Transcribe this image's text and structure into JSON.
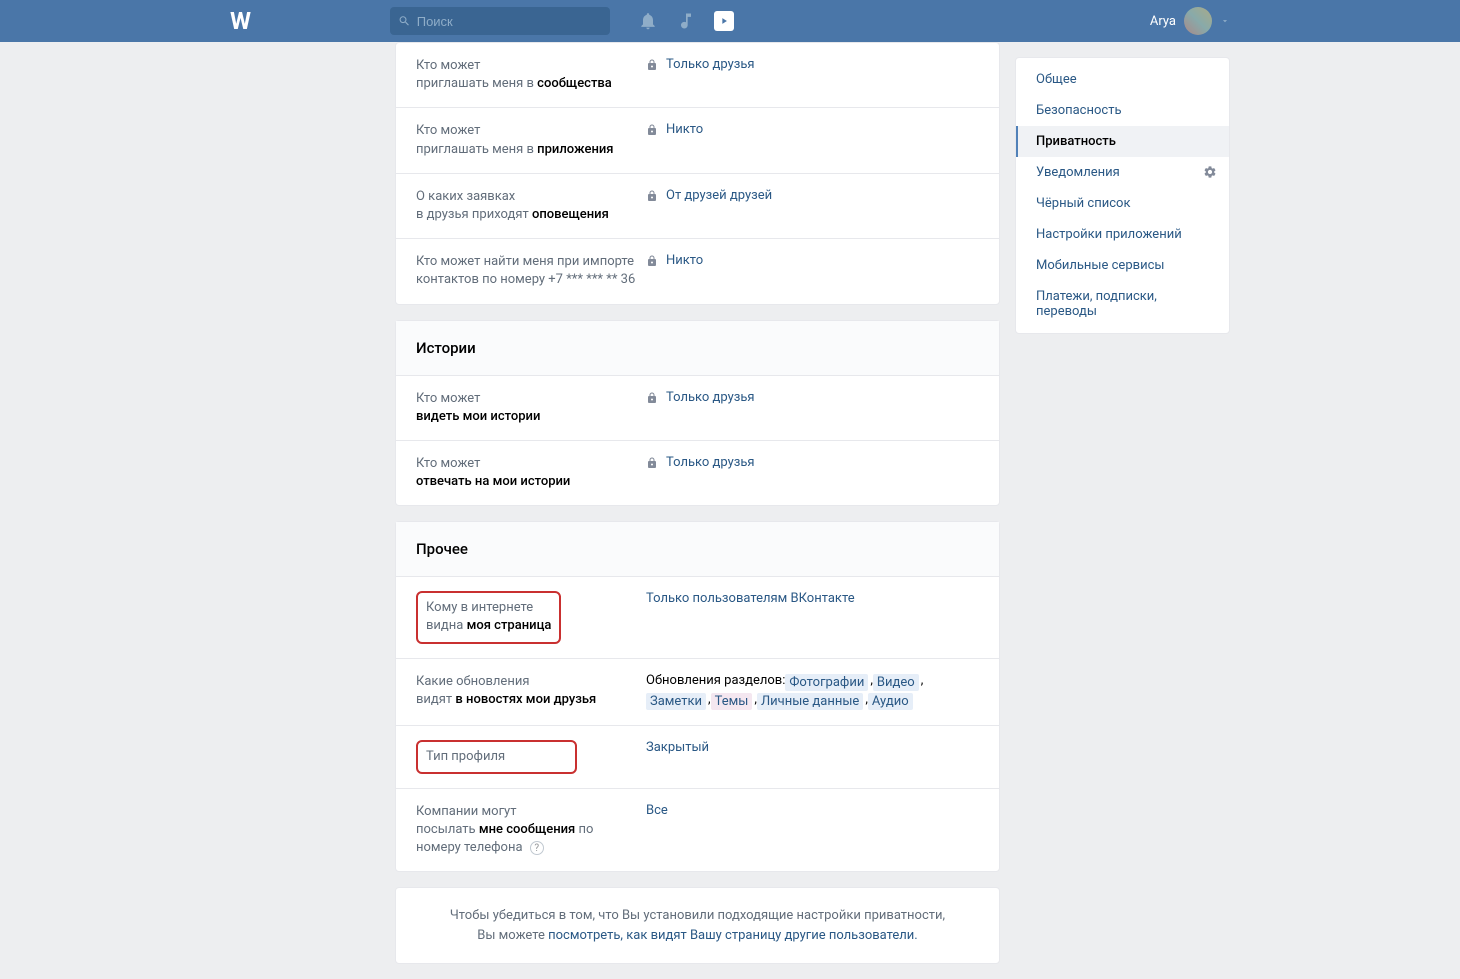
{
  "header": {
    "search_placeholder": "Поиск",
    "user_name": "Arya"
  },
  "sections": [
    {
      "rows": [
        {
          "label_pre": "Кто может",
          "label_bold_pre": "приглашать меня в ",
          "label_bold": "сообщества",
          "value": "Только друзья",
          "locked": true
        },
        {
          "label_pre": "Кто может",
          "label_bold_pre": "приглашать меня в ",
          "label_bold": "приложения",
          "value": "Никто",
          "locked": true
        },
        {
          "label_pre": "О каких заявках",
          "label_bold_pre": "в друзья приходят ",
          "label_bold": "оповещения",
          "value": "От друзей друзей",
          "locked": true
        },
        {
          "label_pre": "Кто может найти меня при импорте",
          "label_bold_pre": "контактов по номеру +7 *** *** ** 36",
          "label_bold": "",
          "value": "Никто",
          "locked": true
        }
      ]
    }
  ],
  "stories": {
    "title": "Истории",
    "rows": [
      {
        "label_pre": "Кто может",
        "label_bold": "видеть мои истории",
        "value": "Только друзья",
        "locked": true
      },
      {
        "label_pre": "Кто может",
        "label_bold": "отвечать на мои истории",
        "value": "Только друзья",
        "locked": true
      }
    ]
  },
  "other": {
    "title": "Прочее",
    "page_visibility": {
      "label_pre": "Кому в интернете",
      "label_bold_pre": "видна ",
      "label_bold": "моя страница",
      "value": "Только пользователям ВКонтакте"
    },
    "updates": {
      "label_pre": "Какие обновления",
      "label_bold_pre": "видят ",
      "label_bold": "в новостях мои друзья",
      "prefix": "Обновления разделов:",
      "tags": [
        "Фотографии",
        "Видео",
        "Заметки",
        "Темы",
        "Личные данные",
        "Аудио"
      ]
    },
    "profile_type": {
      "label": "Тип профиля",
      "value": "Закрытый"
    },
    "companies": {
      "label_pre": "Компании могут",
      "label_bold_pre": "посылать ",
      "label_bold": "мне сообщения",
      "label_post": " по номеру телефона",
      "value": "Все"
    }
  },
  "footer": {
    "text1": "Чтобы убедиться в том, что Вы установили подходящие настройки приватности,",
    "text2": "Вы можете ",
    "link": "посмотреть, как видят Вашу страницу другие пользователи."
  },
  "nav": {
    "items": [
      "Общее",
      "Безопасность",
      "Приватность",
      "Уведомления",
      "Чёрный список",
      "Настройки приложений",
      "Мобильные сервисы",
      "Платежи, подписки, переводы"
    ],
    "active": 2,
    "gear": 3
  }
}
